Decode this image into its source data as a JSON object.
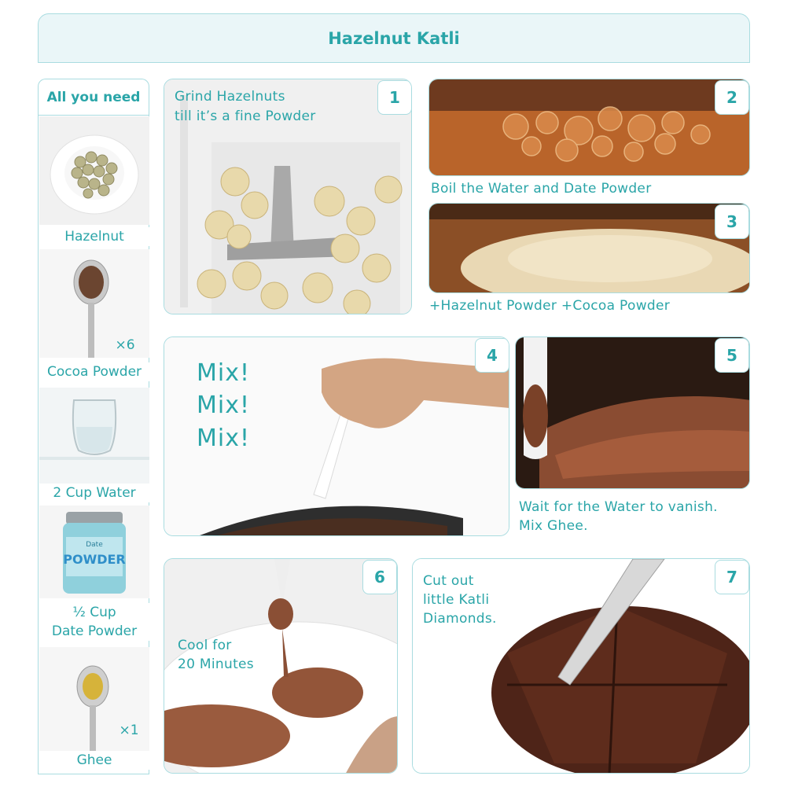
{
  "title": "Hazelnut Katli",
  "ingredients": {
    "heading": "All you need",
    "items": [
      {
        "label": "Hazelnut",
        "qty": ""
      },
      {
        "label": "Cocoa Powder",
        "qty": "×6"
      },
      {
        "label": "2 Cup Water",
        "qty": ""
      },
      {
        "label_line1": "½ Cup",
        "label_line2": "Date Powder",
        "jar_text": "POWDER",
        "jar_sub": "Date"
      },
      {
        "label": "Ghee",
        "qty": "×1"
      }
    ]
  },
  "steps": [
    {
      "number": "1",
      "caption_line1": "Grind Hazelnuts",
      "caption_line2": "till it’s a fine Powder"
    },
    {
      "number": "2",
      "caption": "Boil the Water and Date Powder"
    },
    {
      "number": "3",
      "caption": "+Hazelnut Powder +Cocoa Powder"
    },
    {
      "number": "4",
      "mix": [
        "Mix!",
        "Mix!",
        "Mix!"
      ]
    },
    {
      "number": "5",
      "caption_line1": "Wait for the Water to vanish.",
      "caption_line2": "Mix Ghee."
    },
    {
      "number": "6",
      "caption_line1": "Cool for",
      "caption_line2": "20 Minutes"
    },
    {
      "number": "7",
      "caption_line1": "Cut out",
      "caption_line2": "little Katli",
      "caption_line3": "Diamonds."
    }
  ],
  "colors": {
    "accent": "#2aa5a8",
    "border": "#a9dce0",
    "title_bg": "#eaf6f8"
  }
}
